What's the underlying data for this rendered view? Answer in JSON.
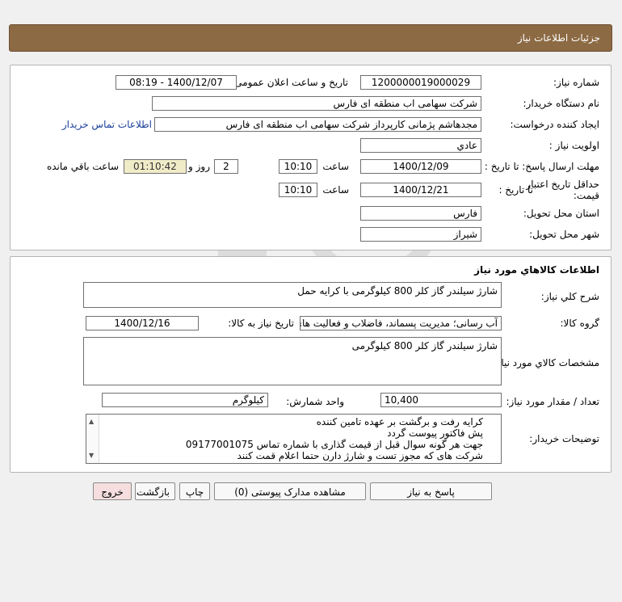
{
  "header": {
    "title": "جزئیات اطلاعات نیاز"
  },
  "info": {
    "need_number_label": "شماره نیاز:",
    "need_number": "1200000019000029",
    "announce_label": "تاریخ و ساعت اعلان عمومی:",
    "announce_value": "1400/12/07 - 08:19",
    "buyer_org_label": "نام دستگاه خریدار:",
    "buyer_org": "شرکت سهامی اب منطقه ای فارس",
    "creator_label": "ایجاد کننده درخواست:",
    "creator": "مجدهاشم پژمانی کارپرداز شرکت سهامی اب منطقه ای فارس",
    "contact_link": "اطلاعات تماس خریدار",
    "priority_label": "اولویت نیاز :",
    "priority": "عادي",
    "deadline_label": "مهلت ارسال پاسخ: تا تاریخ :",
    "deadline_date": "1400/12/09",
    "time_label": "ساعت",
    "deadline_time": "10:10",
    "days_value": "2",
    "days_label": "روز و",
    "remaining_time": "01:10:42",
    "remaining_label": "ساعت باقي مانده",
    "validity_label_1": "حداقل تاریخ اعتبار",
    "validity_label_2": "قیمت:",
    "validity_to_label": "تا تاریخ :",
    "validity_date": "1400/12/21",
    "validity_time_label": "ساعت",
    "validity_time": "10:10",
    "province_label": "استان محل تحویل:",
    "province": "فارس",
    "city_label": "شهر محل تحویل:",
    "city": "شیراز"
  },
  "goods": {
    "section_title": "اطلاعات کالاهاي مورد نياز",
    "summary_label": "شرح کلي نياز:",
    "summary": "شارژ سیلندر گاز کلر 800 کیلوگرمی با کرایه حمل",
    "group_label": "گروه کالا:",
    "group": "آب رسانی؛ مدیریت پسماند، فاضلاب و فعالیت های",
    "need_date_label": "تاریخ نیاز به کالا:",
    "need_date": "1400/12/16",
    "specs_label": "مشخصات کالاي مورد نياز:",
    "specs": "شارژ سیلندر گاز کلر 800 کیلوگرمی",
    "qty_label": "تعداد / مقدار مورد نیاز:",
    "qty": "10,400",
    "unit_label": "واحد شمارش:",
    "unit": "کیلوگرم",
    "notes_label": "توضیحات خریدار:",
    "notes": [
      "کرایه رفت و برگشت بر عهده تامین کننده",
      "پش فاکتور پیوست گردد",
      "جهت هر گونه سوال قبل از قیمت گذاری با شماره تماس 09177001075",
      "شرکت های که مجوز تست و شارژ دارن حتما اعلام قمت کنند"
    ]
  },
  "actions": {
    "reply": "پاسخ به نیاز",
    "attachments": "مشاهده مدارک پیوستی (0)",
    "print": "چاپ",
    "back": "بازگشت",
    "exit": "خروج"
  }
}
